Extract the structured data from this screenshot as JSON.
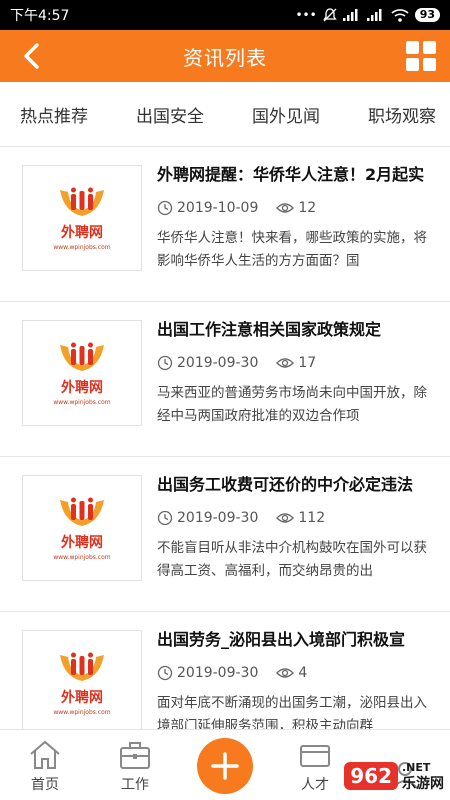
{
  "status": {
    "time": "下午4:57",
    "battery": "93"
  },
  "header": {
    "title": "资讯列表"
  },
  "tabs": [
    "热点推荐",
    "出国安全",
    "国外见闻",
    "职场观察"
  ],
  "logo": {
    "name": "外聘网",
    "url": "www.wpinjobs.com"
  },
  "articles": [
    {
      "title": "外聘网提醒：华侨华人注意！2月起实",
      "date": "2019-10-09",
      "views": "12",
      "summary": "华侨华人注意！快来看，哪些政策的实施，将影响华侨华人生活的方方面面？国"
    },
    {
      "title": "出国工作注意相关国家政策规定",
      "date": "2019-09-30",
      "views": "17",
      "summary": "马来西亚的普通劳务市场尚未向中国开放，除经中马两国政府批准的双边合作项"
    },
    {
      "title": "出国务工收费可还价的中介必定违法",
      "date": "2019-09-30",
      "views": "112",
      "summary": "不能盲目听从非法中介机构鼓吹在国外可以获得高工资、高福利，而交纳昂贵的出"
    },
    {
      "title": "出国劳务_泌阳县出入境部门积极宣",
      "date": "2019-09-30",
      "views": "4",
      "summary": "面对年底不断涌现的出国务工潮，泌阳县出入境部门延伸服务范围，积极主动向群"
    }
  ],
  "nav": {
    "home": "首页",
    "work": "工作",
    "me": "人才"
  },
  "watermark": {
    "badge": "962",
    "net": ".NET",
    "cn": "乐游网"
  },
  "colors": {
    "accent": "#F77B1E"
  }
}
